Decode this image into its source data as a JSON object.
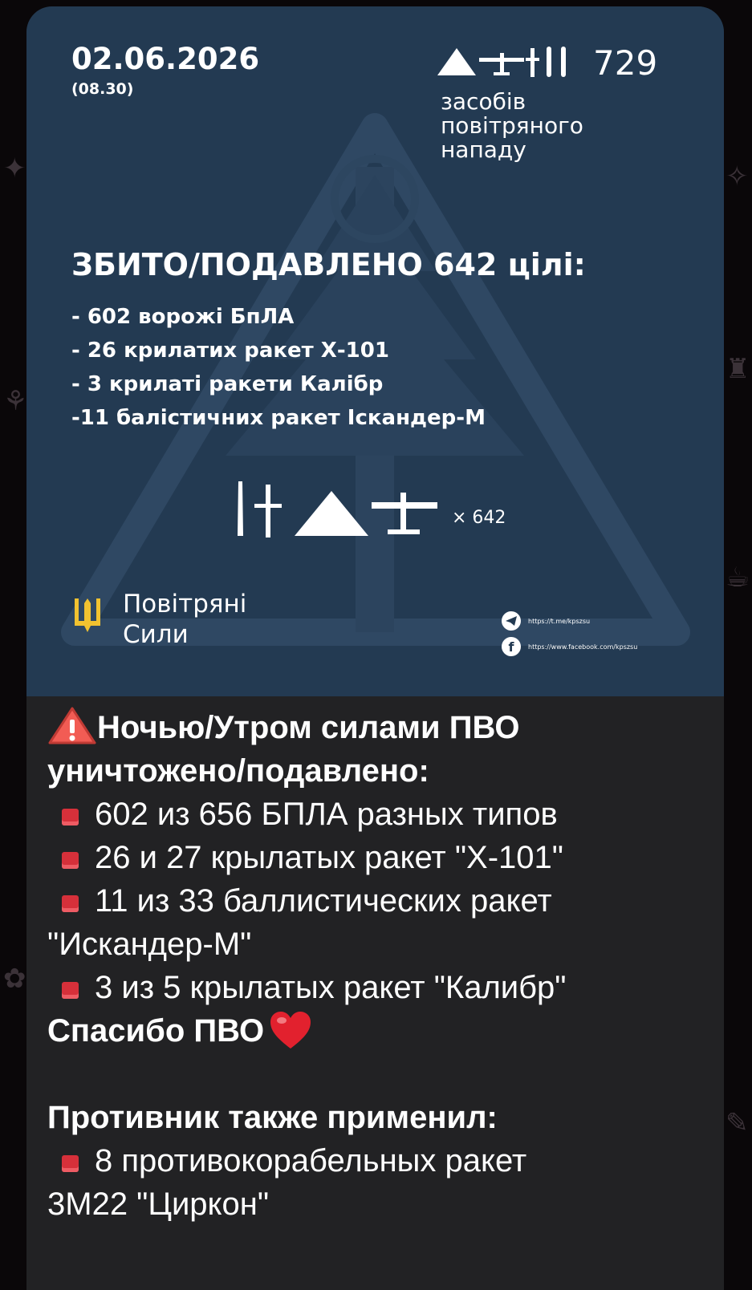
{
  "infographic": {
    "date": "02.06.2026",
    "time": "(08.30)",
    "total_count": "729",
    "total_caption": [
      "засобів",
      "повітряного",
      "нападу"
    ],
    "headline": "ЗБИТО/ПОДАВЛЕНО 642 цілі:",
    "items": [
      "- 602 ворожі БпЛА",
      "- 26  крилатих ракет Х-101",
      "- 3 крилаті ракети Калібр",
      "-11 балістичних ракет Іскандер-М"
    ],
    "multiplier": "× 642",
    "org_name": [
      "Повітряні",
      "Сили"
    ],
    "telegram_link": "https://t.me/kpszsu",
    "facebook_link": "https://www.facebook.com/kpszsu",
    "facebook_glyph": "f"
  },
  "message": {
    "title_line1": "Ночью/Утром силами ПВО",
    "title_line2": "уничтожено/подавлено:",
    "bullets": [
      "602 из 656 БПЛА разных типов",
      "26 и 27 крылатых ракет \"Х-101\"",
      "11 из 33 баллистических ракет",
      "3 из 5 крылатых ракет \"Калибр\""
    ],
    "bullet3_cont": "\"Искандер-М\"",
    "thanks": "Спасибо ПВО",
    "also_title": "Противник также применил:",
    "also_bullet": "8 противокорабельных ракет",
    "also_cont": "3М22 \"Циркон\""
  },
  "colors": {
    "infographic_bg": "#233a52",
    "bubble_bg": "#222224",
    "bullet_square": "#d6303a",
    "trident_yellow": "#f2c230"
  },
  "icons": [
    "warning-icon",
    "heart-icon",
    "telegram-icon",
    "facebook-icon",
    "trident-icon",
    "drone-icon",
    "missile-icon"
  ]
}
